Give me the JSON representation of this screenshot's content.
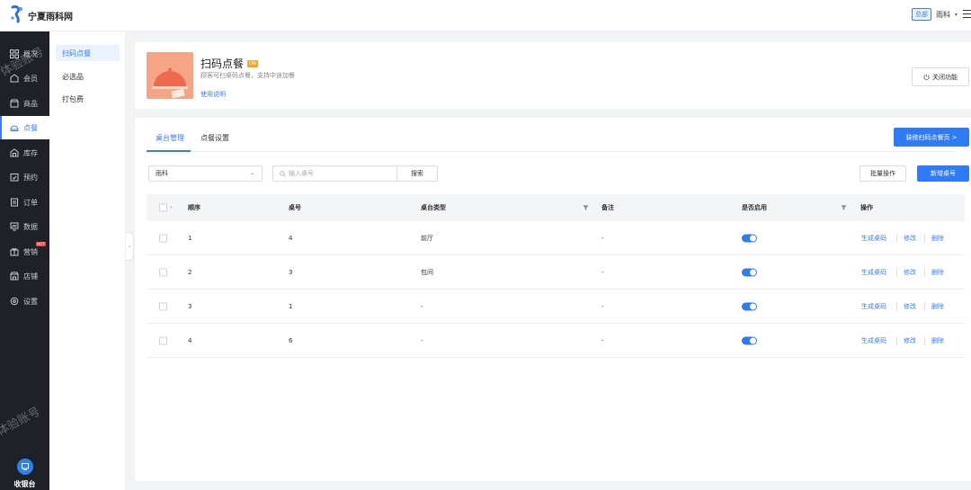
{
  "brand": {
    "name": "宁夏雨科网",
    "logo_icon": "brand-logo-icon"
  },
  "header": {
    "org_badge": "总部",
    "user": "雨科",
    "caret": "▾"
  },
  "sidenav": {
    "items": [
      {
        "label": "概况",
        "icon": "grid-icon"
      },
      {
        "label": "会员",
        "icon": "member-icon"
      },
      {
        "label": "商品",
        "icon": "goods-icon"
      },
      {
        "label": "点餐",
        "icon": "dish-icon",
        "active": true
      },
      {
        "label": "库存",
        "icon": "stock-icon"
      },
      {
        "label": "预约",
        "icon": "calendar-icon"
      },
      {
        "label": "订单",
        "icon": "order-icon"
      },
      {
        "label": "数据",
        "icon": "chart-icon"
      },
      {
        "label": "营销",
        "icon": "marketing-icon",
        "badge": "HOT"
      },
      {
        "label": "店铺",
        "icon": "shop-icon"
      },
      {
        "label": "设置",
        "icon": "settings-icon"
      }
    ],
    "cashier": "收银台",
    "watermark": "体验账号"
  },
  "subnav": {
    "items": [
      {
        "label": "扫码点餐",
        "active": true
      },
      {
        "label": "必选品"
      },
      {
        "label": "打包费"
      }
    ]
  },
  "feature": {
    "title": "扫码点餐",
    "badge": "ON",
    "description": "顾客可扫桌码点餐，支持中途加餐",
    "help_link": "使用说明",
    "close_button": "关闭功能"
  },
  "panel": {
    "tabs": [
      {
        "label": "桌台管理",
        "active": true
      },
      {
        "label": "点餐设置"
      }
    ],
    "decorate_button": "装修扫码点餐页 >",
    "store_select": "雨科",
    "search_placeholder": "输入桌号",
    "search_button": "搜索",
    "batch_button": "批量操作",
    "add_button": "新增桌号"
  },
  "table": {
    "columns": {
      "order": "顺序",
      "table_no": "桌号",
      "type": "桌台类型",
      "remark": "备注",
      "enabled": "是否启用",
      "actions": "操作"
    },
    "rows": [
      {
        "order": "1",
        "table_no": "4",
        "type": "前厅",
        "remark": "-",
        "enabled": true
      },
      {
        "order": "2",
        "table_no": "3",
        "type": "包间",
        "remark": "-",
        "enabled": true
      },
      {
        "order": "3",
        "table_no": "1",
        "type": "-",
        "remark": "-",
        "enabled": true
      },
      {
        "order": "4",
        "table_no": "6",
        "type": "-",
        "remark": "-",
        "enabled": true
      }
    ],
    "actions": {
      "generate": "生成桌码",
      "edit": "修改",
      "delete": "删除"
    }
  }
}
